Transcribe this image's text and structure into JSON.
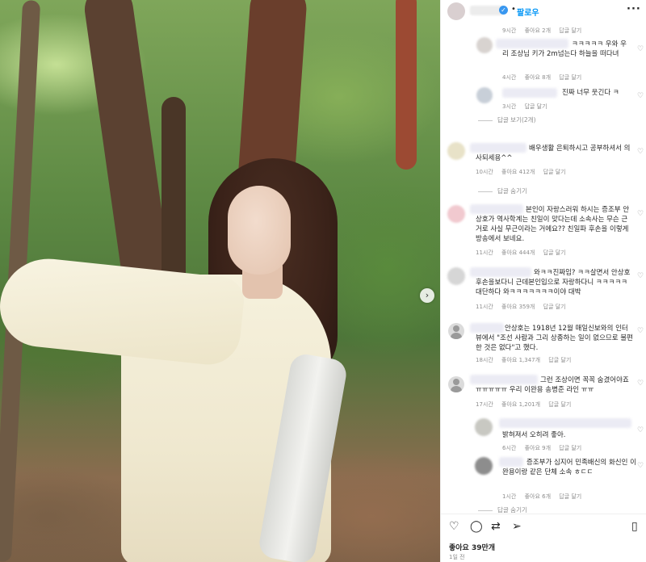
{
  "header": {
    "follow_label": "팔로우",
    "verified_icon": "verified-badge-icon",
    "more_icon": "more-options-icon",
    "separator": "•"
  },
  "comments": [
    {
      "meta": {
        "time": "9시간",
        "likes": "좋아요 2개",
        "reply": "답글 달기"
      }
    },
    {
      "text": "ㅋㅋㅋㅋㅋ 우와 우리 조상님 키가 2m넘는다 하늘을 떠다녀",
      "meta": {
        "time": "4시간",
        "likes": "좋아요 8개",
        "reply": "답글 달기"
      }
    },
    {
      "text": "진짜 너무 웃긴다 ㅋ",
      "meta": {
        "time": "3시간",
        "reply": "답글 달기"
      }
    },
    {
      "more": "답글 보기(2개)"
    },
    {
      "text": "배우생활 은퇴하시고 공부하셔서 의사되세용^^",
      "meta": {
        "time": "10시간",
        "likes": "좋아요 412개",
        "reply": "답글 달기"
      }
    },
    {
      "more": "답글 숨기기"
    },
    {
      "text": "본인이 자랑스러워 하시는 증조부 안상호가 역사학계는 친일이 맞다는데 소속사는 무슨 근거로 사실 무근이라는 거에요?? 친일파 후손을 이렇게 방송에서 보네요.",
      "meta": {
        "time": "11시간",
        "likes": "좋아요 444개",
        "reply": "답글 달기"
      }
    },
    {
      "text": "와ㅋㅋ진짜임? ㅋㅋ살면서 안상호 후손을보다니 근데본인입으로 자랑하다니 ㅋㅋㅋㅋㅋ대단하다 와ㅋㅋㅋㅋㅋㅋㅋ이야 대박",
      "meta": {
        "time": "11시간",
        "likes": "좋아요 359개",
        "reply": "답글 달기"
      }
    },
    {
      "text": "안상호는 1918년 12월 매일신보와의 인터뷰에서 \"조선 사람과 그리 상종하는 일이 없으므로 불편한 것은 없다\"고 했다.",
      "meta": {
        "time": "18시간",
        "likes": "좋아요 1,347개",
        "reply": "답글 달기"
      }
    },
    {
      "text": "그런 조상이면 꼭꼭 숨겼어야죠 ㅠㅠㅠㅠㅠ 우리 이완용 송병준 라인 ㅠㅠ",
      "meta": {
        "time": "17시간",
        "likes": "좋아요 1,201개",
        "reply": "답글 달기"
      }
    },
    {
      "text": "밝혀져서 오히려 좋아.",
      "meta": {
        "time": "6시간",
        "likes": "좋아요 9개",
        "reply": "답글 달기"
      }
    },
    {
      "text": "증조부가 심지어 민족배신의 화신인 이완용이랑 같은 단체 소속 ㅎㄷㄷ",
      "meta": {
        "time": "1시간",
        "likes": "좋아요 6개",
        "reply": "답글 달기"
      }
    },
    {
      "more": "답글 숨기기"
    }
  ],
  "actions": {
    "icons": [
      "heart-icon",
      "comment-icon",
      "repost-icon",
      "share-icon",
      "save-icon"
    ],
    "likes": "좋아요 39만개",
    "time": "1일 전"
  }
}
